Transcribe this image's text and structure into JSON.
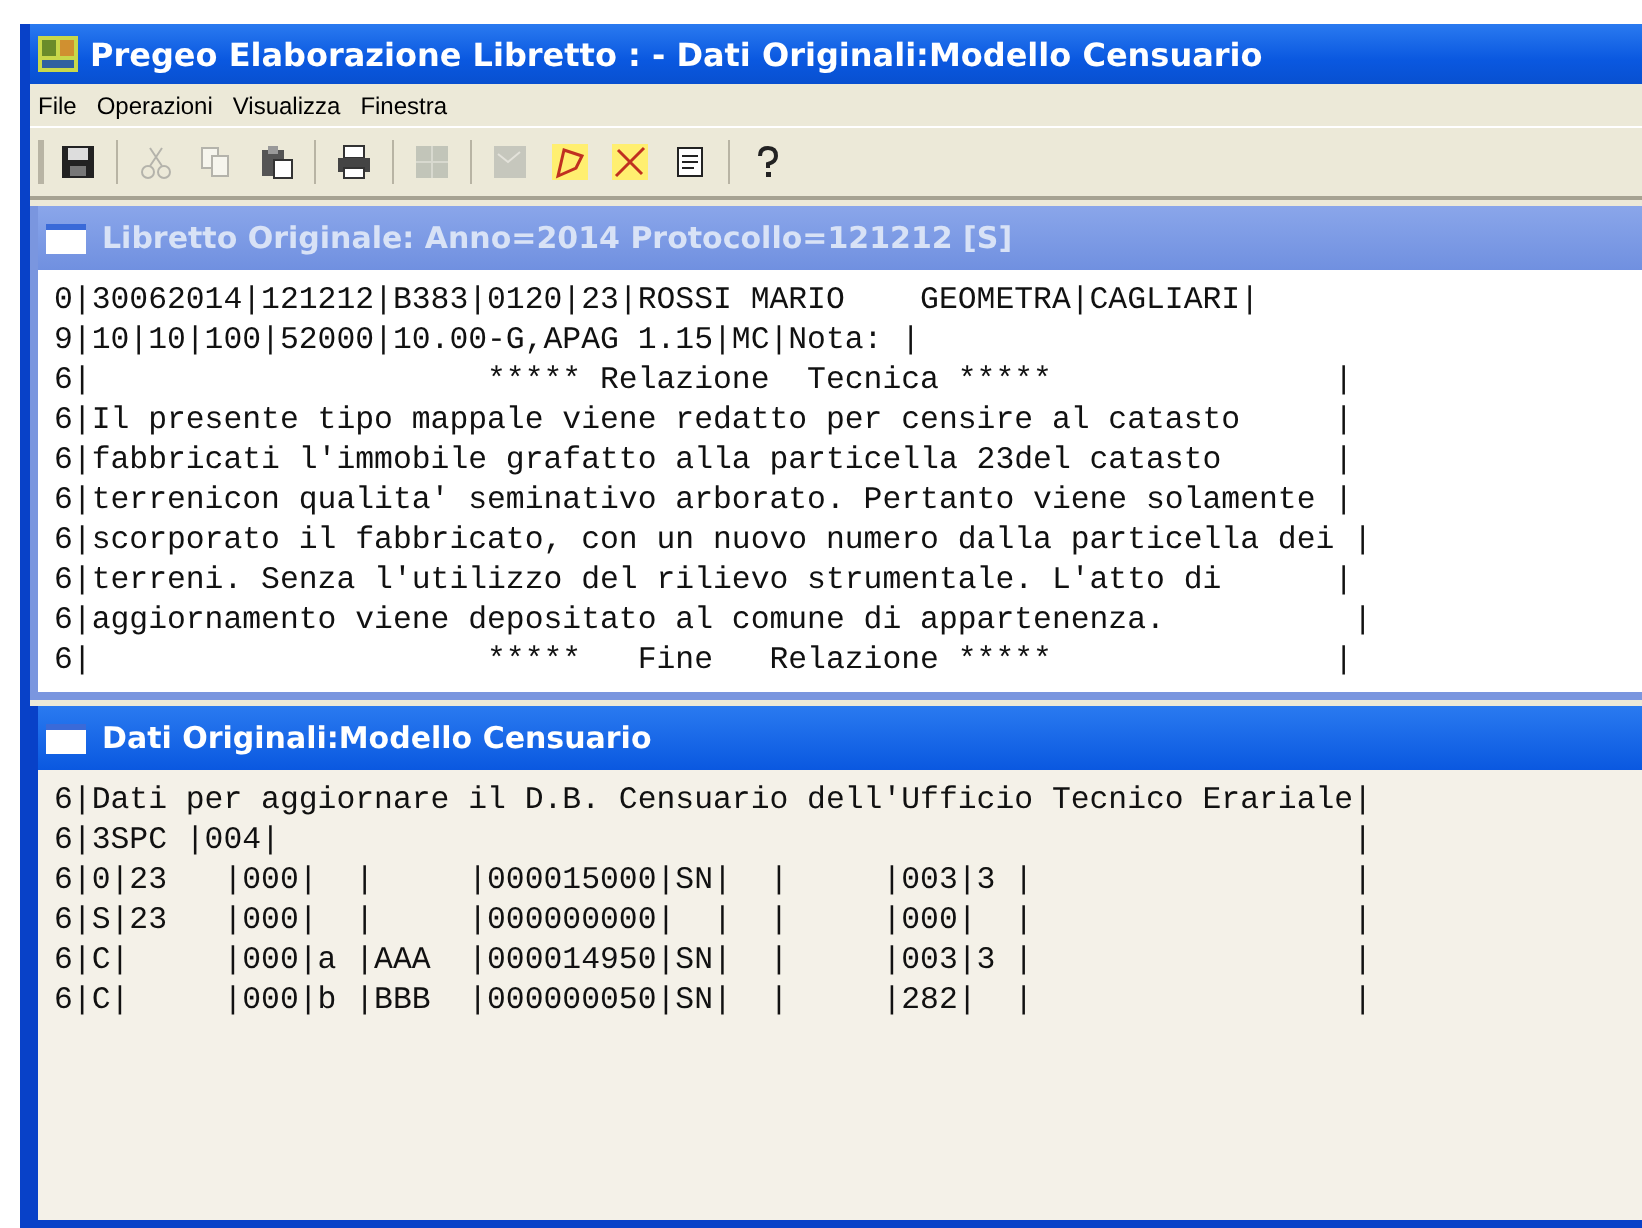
{
  "window": {
    "title": "Pregeo Elaborazione Libretto : - Dati Originali:Modello Censuario"
  },
  "menu": [
    "File",
    "Operazioni",
    "Visualizza",
    "Finestra"
  ],
  "toolbar": [
    {
      "disabled": false
    },
    {
      "disabled": true
    },
    {
      "disabled": true
    },
    {
      "disabled": false
    },
    {
      "disabled": false
    },
    {
      "disabled": true
    },
    {
      "disabled": true
    },
    {
      "disabled": false
    },
    {
      "disabled": false
    },
    {
      "disabled": false
    },
    {
      "disabled": false
    }
  ],
  "child_windows": [
    {
      "title": "Libretto Originale: Anno=2014 Protocollo=121212 [S]",
      "active": false,
      "lines": [
        "0|30062014|121212|B383|0120|23|ROSSI MARIO    GEOMETRA|CAGLIARI|",
        "9|10|10|100|52000|10.00-G,APAG 1.15|MC|Nota: |",
        "6|                     ***** Relazione  Tecnica *****               |",
        "6|Il presente tipo mappale viene redatto per censire al catasto     |",
        "6|fabbricati l'immobile grafatto alla particella 23del catasto      |",
        "6|terrenicon qualita' seminativo arborato. Pertanto viene solamente |",
        "6|scorporato il fabbricato, con un nuovo numero dalla particella dei |",
        "6|terreni. Senza l'utilizzo del rilievo strumentale. L'atto di      |",
        "6|aggiornamento viene depositato al comune di appartenenza.          |",
        "6|                     *****   Fine   Relazione *****               |"
      ]
    },
    {
      "title": "Dati Originali:Modello Censuario",
      "active": true,
      "lines": [
        "6|Dati per aggiornare il D.B. Censuario dell'Ufficio Tecnico Erariale|",
        "6|3SPC |004|                                                         |",
        "6|0|23   |000|  |     |000015000|SN|  |     |003|3 |                 |",
        "6|S|23   |000|  |     |000000000|  |  |     |000|  |                 |",
        "6|C|     |000|a |AAA  |000014950|SN|  |     |003|3 |                 |",
        "6|C|     |000|b |BBB  |000000050|SN|  |     |282|  |                 |"
      ]
    }
  ]
}
